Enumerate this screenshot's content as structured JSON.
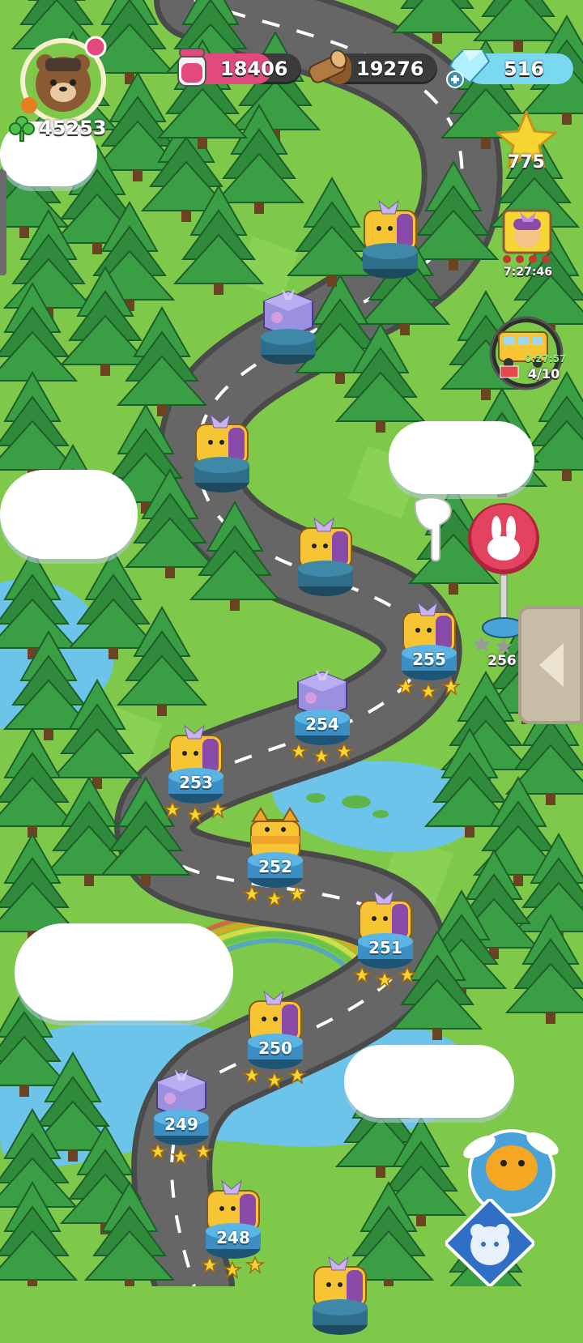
{
  "resources": {
    "clovers": "45253",
    "jam": "18406",
    "wood": "19276",
    "gems": "516",
    "stars": "775"
  },
  "event_timer": "7:27:46",
  "bus_event": {
    "timer": "0:27:57",
    "progress": "4/10"
  },
  "next_level": "256",
  "levels": [
    {
      "num": "255",
      "stars": 3,
      "chest": "golden-cat-chest"
    },
    {
      "num": "254",
      "stars": 3,
      "chest": "purple-box"
    },
    {
      "num": "253",
      "stars": 3,
      "chest": "golden-cat-chest"
    },
    {
      "num": "252",
      "stars": 3,
      "chest": "cat-chest"
    },
    {
      "num": "251",
      "stars": 3,
      "chest": "golden-cat-chest"
    },
    {
      "num": "250",
      "stars": 3,
      "chest": "golden-cat-chest"
    },
    {
      "num": "249",
      "stars": 3,
      "chest": "purple-box"
    },
    {
      "num": "248",
      "stars": 3,
      "chest": "golden-cat-chest"
    }
  ],
  "colors": {
    "grass": "#7fc94a",
    "road": "#5b5b5b",
    "tree": "#2f8a3c",
    "water": "#6cc4ea",
    "jam_bar": "#e24a7d",
    "wood_bar": "#8b5a2b",
    "gem_bar": "#7ad8f0",
    "stop_sign": "#e3435e"
  }
}
